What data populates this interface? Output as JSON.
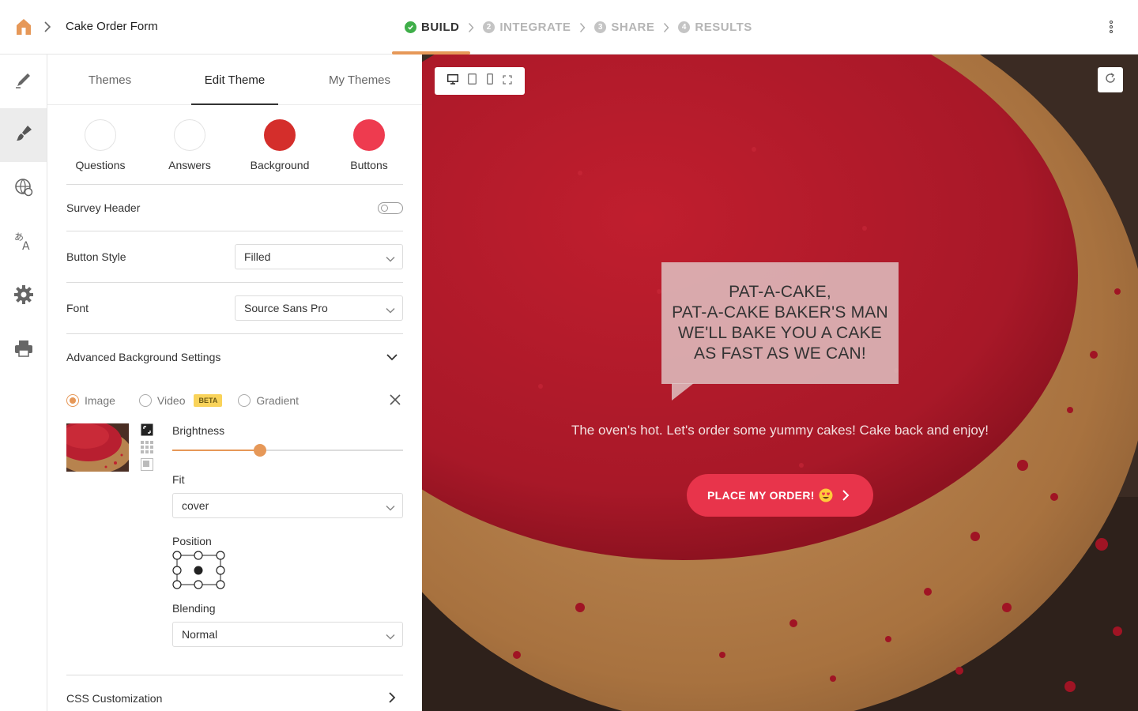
{
  "header": {
    "form_title": "Cake Order Form",
    "steps": [
      {
        "num": "✓",
        "label": "BUILD",
        "active": true
      },
      {
        "num": "2",
        "label": "INTEGRATE",
        "active": false
      },
      {
        "num": "3",
        "label": "SHARE",
        "active": false
      },
      {
        "num": "4",
        "label": "RESULTS",
        "active": false
      }
    ]
  },
  "rail": {
    "items": [
      "pencil-icon",
      "paintbrush-icon",
      "globe-icon",
      "translate-icon",
      "gear-icon",
      "printer-icon"
    ],
    "active_index": 1
  },
  "panel": {
    "tabs": [
      "Themes",
      "Edit Theme",
      "My Themes"
    ],
    "active_tab": "Edit Theme",
    "swatches": [
      {
        "label": "Questions",
        "color": "#ffffff"
      },
      {
        "label": "Answers",
        "color": "#ffffff"
      },
      {
        "label": "Background",
        "color": "#d42e2b"
      },
      {
        "label": "Buttons",
        "color": "#ee3b4f"
      }
    ],
    "survey_header": {
      "label": "Survey Header",
      "enabled": false
    },
    "button_style": {
      "label": "Button Style",
      "value": "Filled"
    },
    "font": {
      "label": "Font",
      "value": "Source Sans Pro"
    },
    "advanced": {
      "label": "Advanced Background Settings",
      "options": [
        "Image",
        "Video",
        "Gradient"
      ],
      "selected": "Image",
      "beta_badge": "BETA",
      "brightness_label": "Brightness",
      "brightness_value": 0.38,
      "fit_label": "Fit",
      "fit_value": "cover",
      "position_label": "Position",
      "position_selected": "center",
      "blending_label": "Blending",
      "blending_value": "Normal"
    },
    "css_label": "CSS Customization"
  },
  "preview": {
    "bubble_text": "PAT-A-CAKE,\nPAT-A-CAKE BAKER'S MAN\nWE'LL BAKE YOU A CAKE\nAS FAST AS WE CAN!",
    "tagline": "The oven's hot. Let's order some yummy cakes! Cake back and enjoy!",
    "cta_label": "PLACE MY ORDER!",
    "accent_color": "#e8344b"
  },
  "colors": {
    "accent": "#e69858",
    "success": "#3fae49"
  }
}
